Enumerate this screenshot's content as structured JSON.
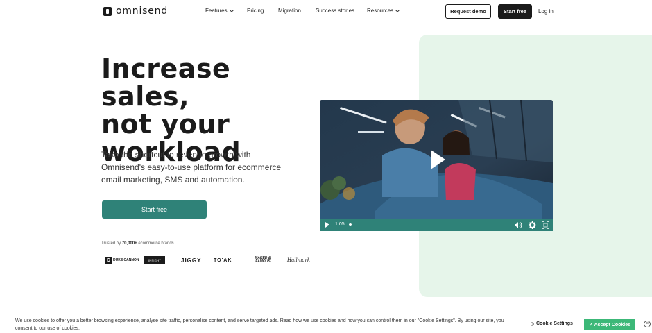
{
  "header": {
    "logo_text": "omnisend",
    "nav": [
      {
        "label": "Features",
        "dropdown": true
      },
      {
        "label": "Pricing",
        "dropdown": false
      },
      {
        "label": "Migration",
        "dropdown": false
      },
      {
        "label": "Success stories",
        "dropdown": false
      },
      {
        "label": "Resources",
        "dropdown": true
      }
    ],
    "request_demo_label": "Request demo",
    "start_free_label": "Start free",
    "login_label": "Log in"
  },
  "hero": {
    "headline_lines": [
      "Increase sales,",
      "not your",
      "workload"
    ],
    "subtext": "Take the shortcut to revenue growth with Omnisend's easy-to-use platform for ecommerce email marketing, SMS and automation.",
    "cta_label": "Start free",
    "trusted_prefix": "Trusted by ",
    "trusted_count": "70,000+",
    "trusted_suffix": " ecommerce brands",
    "brands": {
      "duke_mark": "D",
      "duke_name": "DUKE CANNON",
      "insight": "INSIGHT",
      "jiggy": "JIGGY",
      "toak": "TO'AK",
      "naked": "NAKED & FAMOUS",
      "hallmark": "Hallmark"
    }
  },
  "video": {
    "time": "1:05",
    "progress": 0.0,
    "accent_color": "#2f8278"
  },
  "cookie": {
    "text": "We use cookies to offer you a better browsing experience, analyse site traffic, personalise content, and serve targeted ads. Read how we use cookies and how you can control them in our \"Cookie Settings\". By using our site, you consent to our use of cookies.",
    "settings_label": "Cookie Settings",
    "accept_label": "✓ Accept Cookies",
    "close_glyph": "×"
  },
  "colors": {
    "brand_teal": "#2f8278",
    "panel_green": "#e6f5ea",
    "accept_green": "#3cb878",
    "dark": "#1b1b1b"
  }
}
